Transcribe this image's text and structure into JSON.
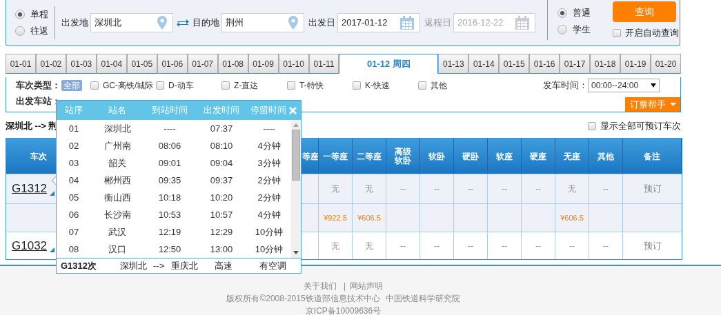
{
  "trip_type": [
    {
      "label": "单程",
      "selected": true
    },
    {
      "label": "往返",
      "selected": false
    }
  ],
  "from": {
    "label": "出发地",
    "value": "深圳北"
  },
  "to": {
    "label": "目的地",
    "value": "荆州"
  },
  "depart_date": {
    "label": "出发日",
    "value": "2017-01-12"
  },
  "return_date": {
    "label": "返程日",
    "value": "2016-12-22",
    "disabled": true
  },
  "passenger_type": [
    {
      "label": "普通",
      "selected": true
    },
    {
      "label": "学生",
      "selected": false
    }
  ],
  "search_button": "查询",
  "auto_query": {
    "label": "开启自动查询",
    "checked": false
  },
  "date_tabs": [
    {
      "label": "01-01",
      "selected": false
    },
    {
      "label": "01-02",
      "selected": false
    },
    {
      "label": "01-03",
      "selected": false
    },
    {
      "label": "01-04",
      "selected": false
    },
    {
      "label": "01-05",
      "selected": false
    },
    {
      "label": "01-06",
      "selected": false
    },
    {
      "label": "01-07",
      "selected": false
    },
    {
      "label": "01-08",
      "selected": false
    },
    {
      "label": "01-09",
      "selected": false
    },
    {
      "label": "01-10",
      "selected": false
    },
    {
      "label": "01-11",
      "selected": false
    },
    {
      "label": "01-12 周四",
      "selected": true
    },
    {
      "label": "01-13",
      "selected": false
    },
    {
      "label": "01-14",
      "selected": false
    },
    {
      "label": "01-15",
      "selected": false
    },
    {
      "label": "01-16",
      "selected": false
    },
    {
      "label": "01-17",
      "selected": false
    },
    {
      "label": "01-18",
      "selected": false
    },
    {
      "label": "01-19",
      "selected": false
    },
    {
      "label": "01-20",
      "selected": false
    }
  ],
  "train_type": {
    "label": "车次类型：",
    "all": {
      "label": "全部",
      "selected": true
    },
    "options": [
      {
        "label": "GC-高铁/城际",
        "checked": false
      },
      {
        "label": "D-动车",
        "checked": false
      },
      {
        "label": "Z-直达",
        "checked": false
      },
      {
        "label": "T-特快",
        "checked": false
      },
      {
        "label": "K-快速",
        "checked": false
      },
      {
        "label": "其他",
        "checked": false
      }
    ]
  },
  "departure_time": {
    "label": "发车时间：",
    "value": "00:00--24:00"
  },
  "station": {
    "label": "出发车站："
  },
  "booking_helper": "订票帮手",
  "route": "深圳北 --> 荆",
  "show_all": {
    "label": "显示全部可预订车次",
    "checked": false
  },
  "table": {
    "columns": [
      "车次",
      "等座",
      "一等座",
      "二等座",
      "高级软卧",
      "软卧",
      "硬卧",
      "软座",
      "硬座",
      "无座",
      "其他",
      "备注"
    ],
    "rows": [
      {
        "kind": "train",
        "cells": [
          "G1312",
          "",
          "无",
          "无",
          "--",
          "--",
          "--",
          "--",
          "--",
          "无",
          "--",
          "预订"
        ]
      },
      {
        "kind": "price",
        "cells": [
          "",
          "",
          "¥922.5",
          "¥606.5",
          "",
          "",
          "",
          "",
          "",
          "¥606.5",
          "",
          ""
        ]
      },
      {
        "kind": "train",
        "cells": [
          "G1032",
          "",
          "无",
          "无",
          "--",
          "--",
          "--",
          "--",
          "--",
          "--",
          "--",
          "预订"
        ]
      }
    ]
  },
  "popup": {
    "columns": [
      "站序",
      "站名",
      "到站时间",
      "出发时间",
      "停留时间"
    ],
    "rows": [
      [
        "01",
        "深圳北",
        "----",
        "07:37",
        "----"
      ],
      [
        "02",
        "广州南",
        "08:06",
        "08:10",
        "4分钟"
      ],
      [
        "03",
        "韶关",
        "09:01",
        "09:04",
        "3分钟"
      ],
      [
        "04",
        "郴州西",
        "09:35",
        "09:37",
        "2分钟"
      ],
      [
        "05",
        "衡山西",
        "10:18",
        "10:20",
        "2分钟"
      ],
      [
        "06",
        "长沙南",
        "10:53",
        "10:57",
        "4分钟"
      ],
      [
        "07",
        "武汉",
        "12:19",
        "12:29",
        "10分钟"
      ],
      [
        "08",
        "汉口",
        "12:50",
        "13:00",
        "10分钟"
      ]
    ],
    "footer": {
      "train": "G1312次",
      "from": "深圳北",
      "arrow": "-->",
      "to": "重庆北",
      "type": "高速",
      "amenity": "有空调"
    }
  },
  "footer": {
    "links": [
      "关于我们",
      "网站声明"
    ],
    "separator": "|",
    "copyright": "版权所有©2008-2015铁道部信息技术中心",
    "institute": "中国铁道科学研究院",
    "icp": "京ICP备10009636号"
  }
}
